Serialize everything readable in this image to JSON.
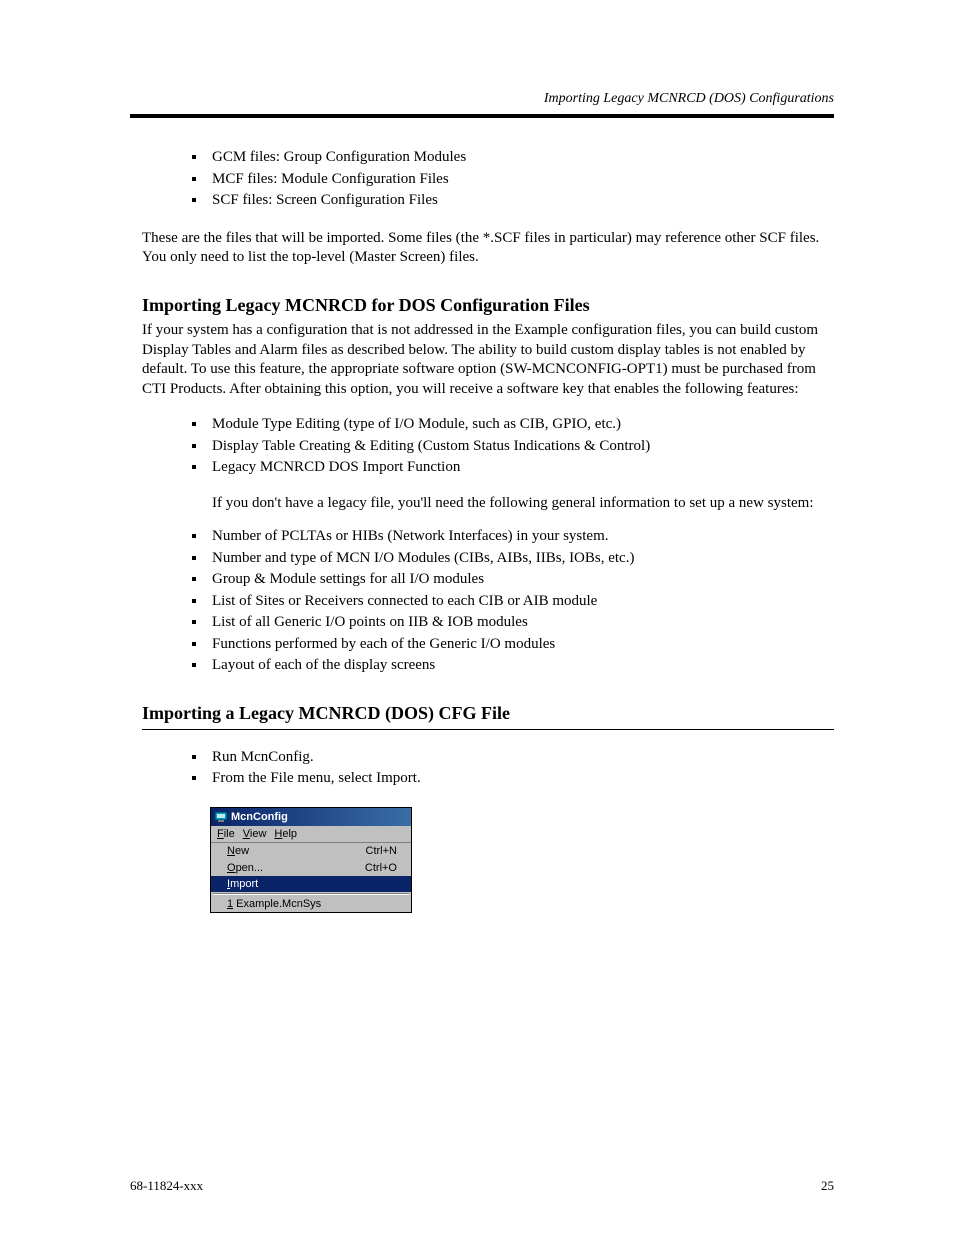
{
  "header": {
    "right": "Importing Legacy MCNRCD (DOS) Configurations"
  },
  "intro_list": [
    "GCM files: Group Configuration Modules",
    "MCF files: Module Configuration Files",
    "SCF files: Screen Configuration Files"
  ],
  "intro_note": "These are the files that will be imported. Some files (the *.SCF files in particular) may reference other SCF files. You only need to list the top-level (Master Screen) files.",
  "section1_title": "Importing Legacy MCNRCD for DOS Configuration Files",
  "config_info": "If your system has a configuration that is not addressed in the Example configuration files, you can build custom Display Tables and Alarm files as described below. The ability to build custom display tables is not enabled by default. To use this feature, the appropriate software option (SW-MCNCONFIG-OPT1) must be purchased from CTI Products.  After obtaining this option, you will receive a software key that enables the following features:",
  "features_list": [
    "Module Type Editing (type of I/O Module, such as CIB, GPIO, etc.)",
    "Display Table Creating & Editing (Custom Status Indications & Control)",
    "Legacy MCNRCD DOS Import Function"
  ],
  "cfg_note": "If you don't have a legacy file, you'll need the following general information to set up a new system:",
  "system_list": [
    "Number of PCLTAs or HIBs (Network Interfaces) in your system.",
    "Number and type of MCN I/O Modules (CIBs, AIBs, IIBs, IOBs, etc.)",
    "Group & Module settings for all I/O modules",
    "List of Sites or Receivers connected to each CIB or AIB module",
    "List of all Generic I/O points on IIB & IOB modules",
    "Functions performed by each of the Generic I/O modules",
    "Layout of each of the display screens"
  ],
  "section2_title": "Importing a Legacy MCNRCD (DOS) CFG File",
  "section2_list": [
    "Run McnConfig.",
    "From the File menu, select Import."
  ],
  "app": {
    "title": "McnConfig",
    "menubar": [
      "File",
      "View",
      "Help"
    ],
    "menu": {
      "new": {
        "label": "New",
        "shortcut": "Ctrl+N"
      },
      "open": {
        "label": "Open...",
        "shortcut": "Ctrl+O"
      },
      "import": {
        "label": "Import"
      },
      "recent": {
        "label": "1 Example.McnSys"
      }
    }
  },
  "footer": {
    "left": "68-11824-xxx",
    "right": "25"
  }
}
